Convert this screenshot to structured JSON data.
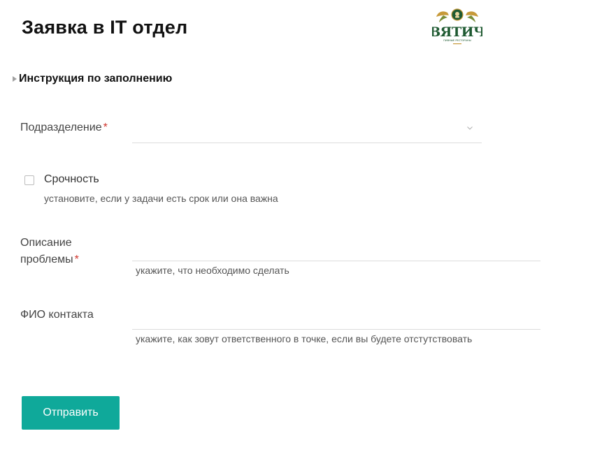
{
  "page": {
    "title": "Заявка в IT отдел"
  },
  "logo": {
    "text": "ВЯТИЧ",
    "tagline": "ПИВНЫЕ РЕСТОРАНЫ"
  },
  "instructions": {
    "label": "Инструкция по заполнению"
  },
  "fields": {
    "department": {
      "label": "Подразделение",
      "required_mark": "*",
      "value": ""
    },
    "urgency": {
      "label": "Срочность",
      "hint": "установите, если у задачи есть срок или она важна",
      "checked": false
    },
    "description": {
      "label_line1": "Описание",
      "label_line2": "проблемы",
      "required_mark": "*",
      "value": "",
      "hint": "укажите, что необходимо сделать"
    },
    "contact": {
      "label": "ФИО контакта",
      "value": "",
      "hint": "укажите, как зовут ответственного в точке, если вы будете отстутствовать"
    }
  },
  "submit": {
    "label": "Отправить"
  },
  "colors": {
    "accent": "#0fa99a",
    "required": "#d0342c",
    "logo_green": "#1f5a32",
    "logo_gold": "#c79a3a"
  },
  "icons": {
    "instructions_toggle": "triangle-right-icon",
    "select_chevron": "chevron-down-icon"
  }
}
